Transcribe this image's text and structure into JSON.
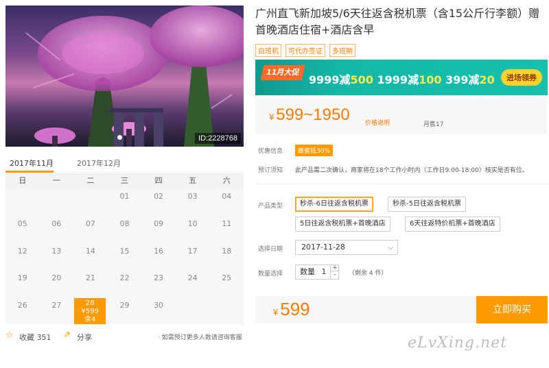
{
  "photo": {
    "id_label": "ID:2228768"
  },
  "calendar": {
    "tabs": [
      "2017年11月",
      "2017年12月"
    ],
    "weekdays": [
      "日",
      "一",
      "二",
      "三",
      "四",
      "五",
      "六"
    ],
    "rows": [
      [
        "",
        "",
        "",
        "01",
        "02",
        "03",
        "04"
      ],
      [
        "05",
        "06",
        "07",
        "08",
        "09",
        "10",
        "11"
      ],
      [
        "12",
        "13",
        "14",
        "15",
        "16",
        "17",
        "18"
      ],
      [
        "19",
        "20",
        "21",
        "22",
        "23",
        "24",
        "25"
      ],
      [
        "26",
        "27",
        "28",
        "29",
        "30",
        "",
        ""
      ]
    ],
    "selected": {
      "day": "28",
      "price": "¥599",
      "stock": "余4"
    }
  },
  "bottom": {
    "favorite": "收藏 351",
    "share": "分享",
    "note": "· 如需预订更多人数请咨询客服"
  },
  "product": {
    "title": "广州直飞新加坡5/6天往返含税机票（含15公斤行李额）赠首晚酒店住宿+酒店含早",
    "tags": [
      "白班机",
      "可代办签证",
      "多班期"
    ]
  },
  "promo": {
    "badge": "11月大促",
    "deal1_a": "9999减",
    "deal1_b": "500",
    "deal2_a": "1999减",
    "deal2_b": "100",
    "deal3_a": "399减",
    "deal3_b": "20",
    "button": "进场领券"
  },
  "price": {
    "currency": "¥",
    "range": "599~1950",
    "note": "价格说明",
    "sold": "月售17"
  },
  "info": {
    "discount_label": "优惠信息",
    "discount_value": "蜂蜜抵30%",
    "notice_label": "预订须知",
    "notice_value": "此产品需二次确认，商家将在18个工作小时内（工作日9:00-18:00）核实是否有位。"
  },
  "options": {
    "type_label": "产品类型",
    "types": [
      "秒杀-6日往返含税机票",
      "秒杀-5日往返含税机票",
      "5日往返含税机票+首晚酒店",
      "6天往返特价机票+首晚酒店"
    ],
    "date_label": "选择日期",
    "date_value": "2017-11-28",
    "qty_label": "数量选择",
    "qty_text": "数量",
    "qty_value": "1",
    "plus": "+",
    "minus": "-",
    "stock": "（剩余 4 件）"
  },
  "buy": {
    "currency": "¥",
    "price": "599",
    "button": "立即购买"
  },
  "watermark": "eLvXing.net",
  "colors": {
    "accent": "#ff9a00",
    "price": "#ff7a00",
    "promo_bg": "#14b8a6"
  }
}
